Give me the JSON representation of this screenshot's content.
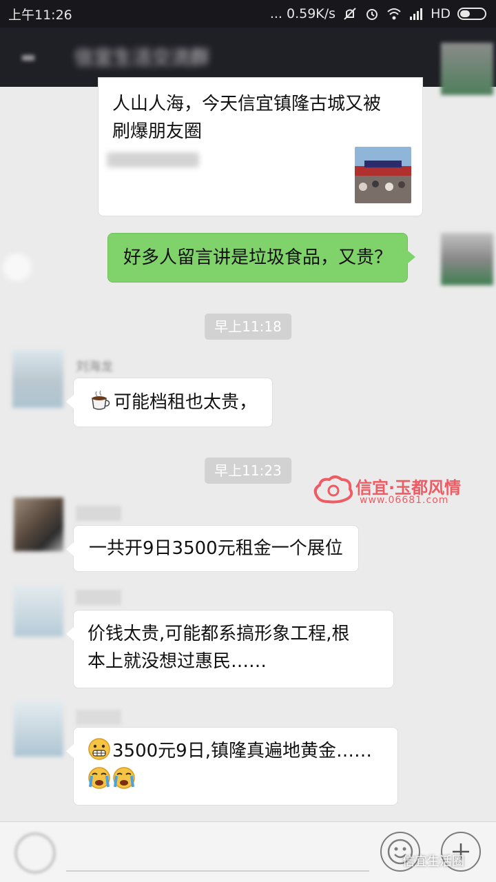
{
  "status_bar": {
    "time": "上午11:26",
    "network_speed": "... 0.59K/s",
    "hd": "HD",
    "icons": [
      "mute-icon",
      "alarm-icon",
      "wifi-icon",
      "signal-icon",
      "battery-icon"
    ]
  },
  "title_bar": {
    "title": "信宜生活交流群",
    "back_icon": "back-arrow-icon"
  },
  "messages": [
    {
      "id": "m1",
      "side": "left",
      "text_lines": [
        "人山人海，今天信宜镇隆古城又被",
        "刷爆朋友圈"
      ],
      "has_link_thumbnail": true
    },
    {
      "id": "m2",
      "side": "right",
      "text": "好多人留言讲是垃圾食品，又贵？"
    },
    {
      "id": "t1",
      "type": "timestamp",
      "text": "早上11:18"
    },
    {
      "id": "m3",
      "side": "left",
      "sender": "刘海龙",
      "emoji": "hot-beverage-emoji",
      "text": "可能档租也太贵，"
    },
    {
      "id": "t2",
      "type": "timestamp",
      "text": "早上11:23"
    },
    {
      "id": "m4",
      "side": "left",
      "text": "一共开9日3500元租金一个展位"
    },
    {
      "id": "m5",
      "side": "left",
      "text_lines": [
        "价钱太贵,可能都系搞形象工程,根",
        "本上就没想过惠民……"
      ]
    },
    {
      "id": "m6",
      "side": "left",
      "emoji_lead": "grimacing-face-emoji",
      "text": "3500元9日,镇隆真遍地黄金……",
      "trailing_emojis": [
        "loudly-crying-face-emoji",
        "loudly-crying-face-emoji"
      ]
    }
  ],
  "watermark": {
    "title": "信宜·玉都风情",
    "url": "www.06681.com"
  },
  "footer_tag": "信宜生活圈",
  "colors": {
    "background": "#ebebeb",
    "status_bar": "#17171c",
    "title_bar": "#1f1f26",
    "my_bubble": "#7fd36a",
    "other_bubble": "#ffffff",
    "timestamp_bg": "#d2d2d2",
    "watermark": "#ee5b63"
  }
}
